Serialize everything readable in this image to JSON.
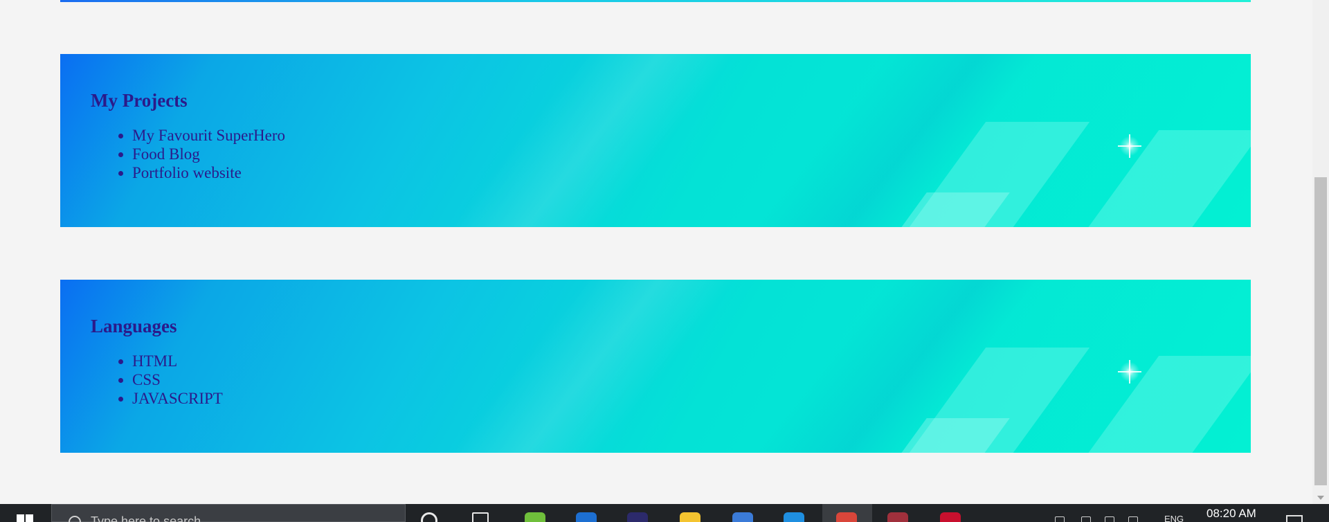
{
  "sections": [
    {
      "title": "My Projects",
      "items": [
        "My Favourit SuperHero",
        "Food Blog",
        "Portfolio website"
      ]
    },
    {
      "title": "Languages",
      "items": [
        "HTML",
        "CSS",
        "JAVASCRIPT"
      ]
    }
  ],
  "taskbar": {
    "search_placeholder": "Type here to search",
    "language": "ENG",
    "time": "08:20 AM",
    "pinned_icons": [
      {
        "name": "cortana-icon",
        "color": "#202326"
      },
      {
        "name": "task-view-icon",
        "color": "#202326"
      },
      {
        "name": "green-app-icon",
        "color": "#6fbf3b"
      },
      {
        "name": "mail-icon",
        "color": "#1d6fd1"
      },
      {
        "name": "eclipse-icon",
        "color": "#2c2a6b"
      },
      {
        "name": "file-explorer-icon",
        "color": "#f4c430"
      },
      {
        "name": "powershell-icon",
        "color": "#3b7bd8"
      },
      {
        "name": "vscode-icon",
        "color": "#1f8fe0"
      },
      {
        "name": "chrome-icon",
        "color": "#d9463a"
      },
      {
        "name": "winrar-icon",
        "color": "#a0303c"
      },
      {
        "name": "red-app-icon",
        "color": "#c8102e"
      }
    ]
  },
  "colors": {
    "page_background": "#f4f4f4",
    "heading_text": "#2b1a8a",
    "card_gradient_start": "#0a6ef2",
    "card_gradient_end": "#03f0d3",
    "taskbar": "#202326"
  }
}
